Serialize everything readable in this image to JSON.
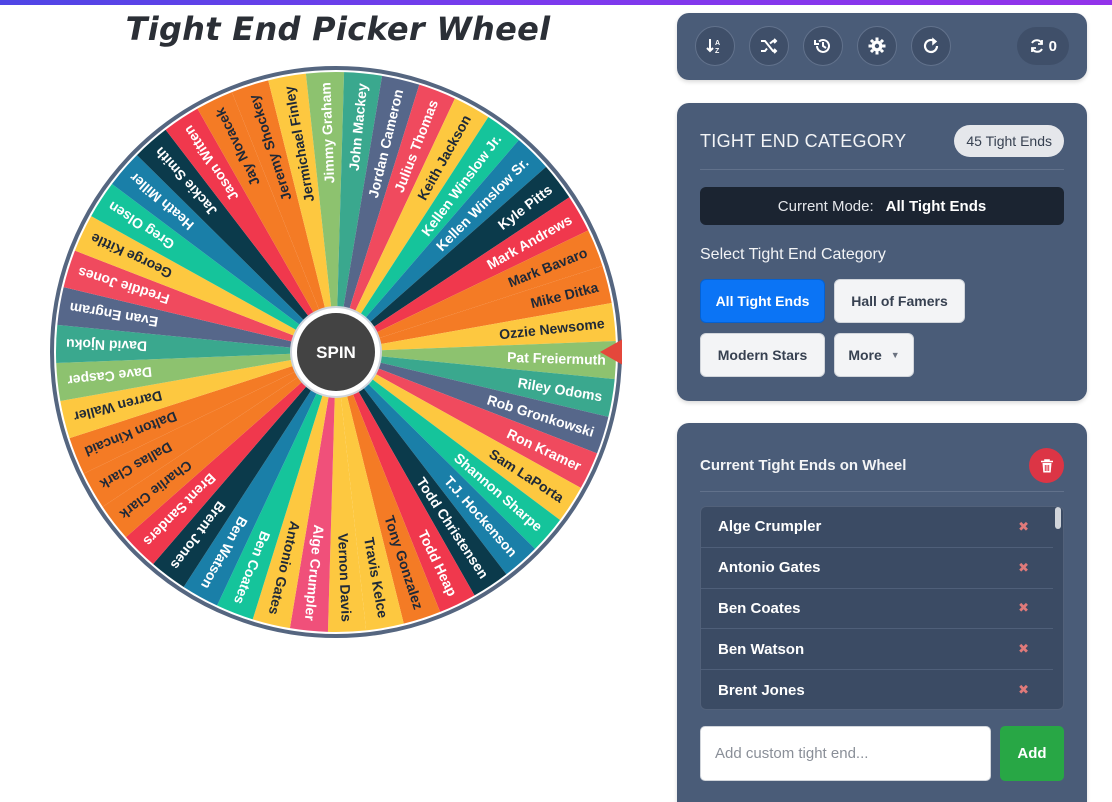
{
  "title": "Tight End Picker Wheel",
  "wheel": {
    "spin_label": "SPIN",
    "segments": [
      {
        "label": "Mike Ditka",
        "color": "#f47b25"
      },
      {
        "label": "Ozzie Newsome",
        "color": "#fdc840"
      },
      {
        "label": "Pat Freiermuth",
        "color": "#8dc26f"
      },
      {
        "label": "Riley Odoms",
        "color": "#3aa88e"
      },
      {
        "label": "Rob Gronkowski",
        "color": "#56678a"
      },
      {
        "label": "Ron Kramer",
        "color": "#f04a5e"
      },
      {
        "label": "Sam LaPorta",
        "color": "#fdc840"
      },
      {
        "label": "Shannon Sharpe",
        "color": "#15c49b"
      },
      {
        "label": "T.J. Hockenson",
        "color": "#1a7fa8"
      },
      {
        "label": "Todd Christensen",
        "color": "#0b3a4b"
      },
      {
        "label": "Todd Heap",
        "color": "#f0384d"
      },
      {
        "label": "Tony Gonzalez",
        "color": "#f47b25"
      },
      {
        "label": "Travis Kelce",
        "color": "#fdc840"
      },
      {
        "label": "Vernon Davis",
        "color": "#fdc840"
      },
      {
        "label": "Alge Crumpler",
        "color": "#f0507a"
      },
      {
        "label": "Antonio Gates",
        "color": "#fdc840"
      },
      {
        "label": "Ben Coates",
        "color": "#15c49b"
      },
      {
        "label": "Ben Watson",
        "color": "#1a7fa8"
      },
      {
        "label": "Brent Jones",
        "color": "#0b3a4b"
      },
      {
        "label": "Brent Sanders",
        "color": "#f0384d"
      },
      {
        "label": "Charlie Clark",
        "color": "#f47b25"
      },
      {
        "label": "Dallas Clark",
        "color": "#f47b25"
      },
      {
        "label": "Dalton Kincaid",
        "color": "#f47b25"
      },
      {
        "label": "Darren Waller",
        "color": "#fdc840"
      },
      {
        "label": "Dave Casper",
        "color": "#8dc26f"
      },
      {
        "label": "David Njoku",
        "color": "#3aa88e"
      },
      {
        "label": "Evan Engram",
        "color": "#56678a"
      },
      {
        "label": "Freddie Jones",
        "color": "#f04a5e"
      },
      {
        "label": "George Kittle",
        "color": "#fdc840"
      },
      {
        "label": "Greg Olsen",
        "color": "#15c49b"
      },
      {
        "label": "Heath Miller",
        "color": "#1a7fa8"
      },
      {
        "label": "Jackie Smith",
        "color": "#0b3a4b"
      },
      {
        "label": "Jason Witten",
        "color": "#f0384d"
      },
      {
        "label": "Jay Novacek",
        "color": "#f47b25"
      },
      {
        "label": "Jeremy Shockey",
        "color": "#f47b25"
      },
      {
        "label": "Jermichael Finley",
        "color": "#fdc840"
      },
      {
        "label": "Jimmy Graham",
        "color": "#8dc26f"
      },
      {
        "label": "John Mackey",
        "color": "#3aa88e"
      },
      {
        "label": "Jordan Cameron",
        "color": "#56678a"
      },
      {
        "label": "Julius Thomas",
        "color": "#f04a5e"
      },
      {
        "label": "Keith Jackson",
        "color": "#fdc840"
      },
      {
        "label": "Kellen Winslow Jr.",
        "color": "#15c49b"
      },
      {
        "label": "Kellen Winslow Sr.",
        "color": "#1a7fa8"
      },
      {
        "label": "Kyle Pitts",
        "color": "#0b3a4b"
      },
      {
        "label": "Mark Andrews",
        "color": "#f0384d"
      },
      {
        "label": "Mark Bavaro",
        "color": "#f47b25"
      }
    ]
  },
  "toolbar": {
    "buttons": [
      "sort-icon",
      "shuffle-icon",
      "history-icon",
      "gear-icon",
      "reset-icon"
    ],
    "counter": "0"
  },
  "category": {
    "heading": "TIGHT END CATEGORY",
    "count_badge": "45 Tight Ends",
    "mode_label": "Current Mode:",
    "mode_value": "All Tight Ends",
    "select_label": "Select Tight End Category",
    "buttons": {
      "all": "All Tight Ends",
      "hof": "Hall of Famers",
      "modern": "Modern Stars",
      "more": "More"
    }
  },
  "current": {
    "heading": "Current Tight Ends on Wheel",
    "items": [
      "Alge Crumpler",
      "Antonio Gates",
      "Ben Coates",
      "Ben Watson",
      "Brent Jones"
    ],
    "input_placeholder": "Add custom tight end...",
    "add_label": "Add"
  },
  "colors": {
    "panel": "#4a5c78",
    "active_button": "#0b74f5",
    "add_button": "#28a745",
    "danger": "#dc3545",
    "pointer": "#e4473b"
  }
}
